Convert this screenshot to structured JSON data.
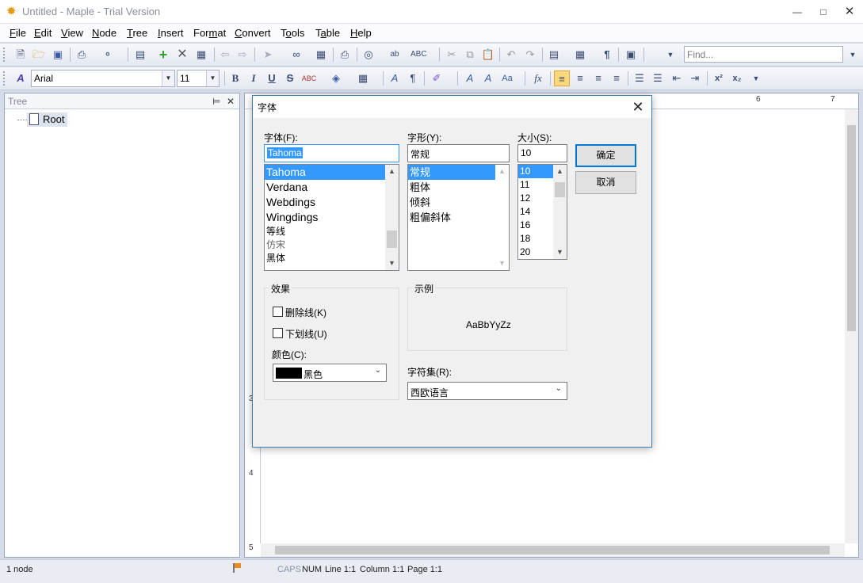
{
  "window": {
    "title": "Untitled - Maple - Trial Version"
  },
  "menu": [
    {
      "label": "File",
      "key": "F"
    },
    {
      "label": "Edit",
      "key": "E"
    },
    {
      "label": "View",
      "key": "V"
    },
    {
      "label": "Node",
      "key": "N"
    },
    {
      "label": "Tree",
      "key": "T"
    },
    {
      "label": "Insert",
      "key": "I"
    },
    {
      "label": "Format",
      "key": "m"
    },
    {
      "label": "Convert",
      "key": "C"
    },
    {
      "label": "Tools",
      "key": "o"
    },
    {
      "label": "Table",
      "key": "a"
    },
    {
      "label": "Help",
      "key": "H"
    }
  ],
  "toolbar": {
    "find_placeholder": "Find...",
    "font_name": "Arial",
    "font_size": "11"
  },
  "tree": {
    "header": "Tree",
    "root_label": "Root"
  },
  "ruler": {
    "top_numbers": [
      "6",
      "7"
    ],
    "left_numbers": [
      "3",
      "4",
      "5"
    ]
  },
  "status": {
    "nodes": "1 node",
    "caps": "CAPS",
    "num": "NUM",
    "line": "Line 1:1",
    "column": "Column 1:1",
    "page": "Page 1:1"
  },
  "dialog": {
    "title": "字体",
    "font_label": "字体(F):",
    "font_value": "Tahoma",
    "font_list": [
      "Tahoma",
      "Verdana",
      "Webdings",
      "Wingdings",
      "等线",
      "仿宋",
      "黑体"
    ],
    "style_label": "字形(Y):",
    "style_value": "常规",
    "style_list": [
      "常规",
      "粗体",
      "倾斜",
      "粗偏斜体"
    ],
    "size_label": "大小(S):",
    "size_value": "10",
    "size_list": [
      "10",
      "11",
      "12",
      "14",
      "16",
      "18",
      "20"
    ],
    "ok_label": "确定",
    "cancel_label": "取消",
    "effects_title": "效果",
    "strikeout_label": "删除线(K)",
    "underline_label": "下划线(U)",
    "color_label": "颜色(C):",
    "color_value": "黑色",
    "sample_title": "示例",
    "sample_text": "AaBbYyZz",
    "charset_label": "字符集(R):",
    "charset_value": "西欧语言"
  }
}
